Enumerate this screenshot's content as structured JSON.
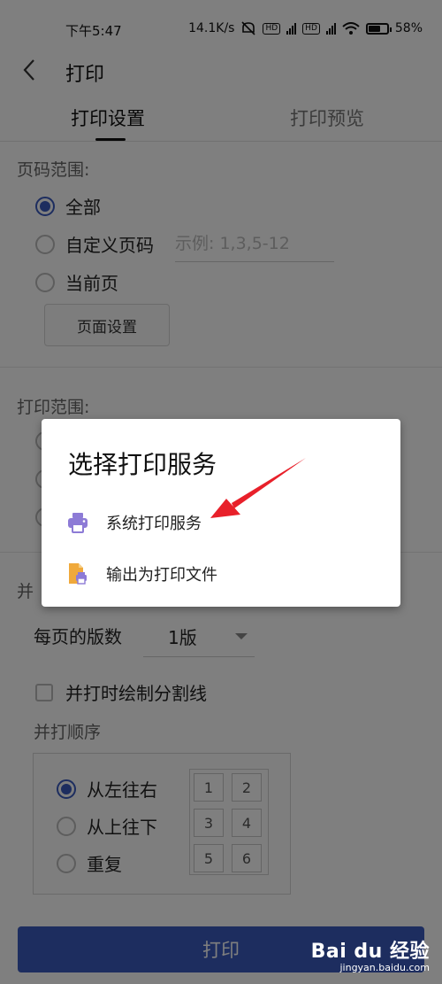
{
  "status_bar": {
    "time": "下午5:47",
    "speed": "14.1K/s",
    "battery": "58%",
    "battery_level": 0.58
  },
  "header": {
    "title": "打印"
  },
  "tabs": [
    "打印设置",
    "打印预览"
  ],
  "page_range": {
    "label": "页码范围:",
    "options": [
      "全部",
      "自定义页码",
      "当前页"
    ],
    "selected_index": 0,
    "custom_placeholder": "示例: 1,3,5-12",
    "page_setup_button": "页面设置"
  },
  "print_range": {
    "label": "打印范围:"
  },
  "merge": {
    "section_label_partial": "并",
    "pages_per_sheet_label": "每页的版数",
    "pages_per_sheet_value": "1版",
    "draw_divider_label": "并打时绘制分割线",
    "order_label": "并打顺序",
    "order_options": [
      "从左往右",
      "从上往下",
      "重复"
    ],
    "order_selected_index": 0,
    "grid_numbers": [
      "1",
      "2",
      "3",
      "4",
      "5",
      "6"
    ]
  },
  "print_button": "打印",
  "dialog": {
    "title": "选择打印服务",
    "options": [
      {
        "label": "系统打印服务",
        "icon": "printer-icon"
      },
      {
        "label": "输出为打印文件",
        "icon": "print-file-icon"
      }
    ]
  },
  "watermark": {
    "brand": "Bai du 经验",
    "site": "jingyan.baidu.com"
  },
  "colors": {
    "accent": "#3a5bbf",
    "annotation_arrow": "#e8202a",
    "printer_icon": "#8d7bd6",
    "file_icon": "#f0a93b"
  }
}
